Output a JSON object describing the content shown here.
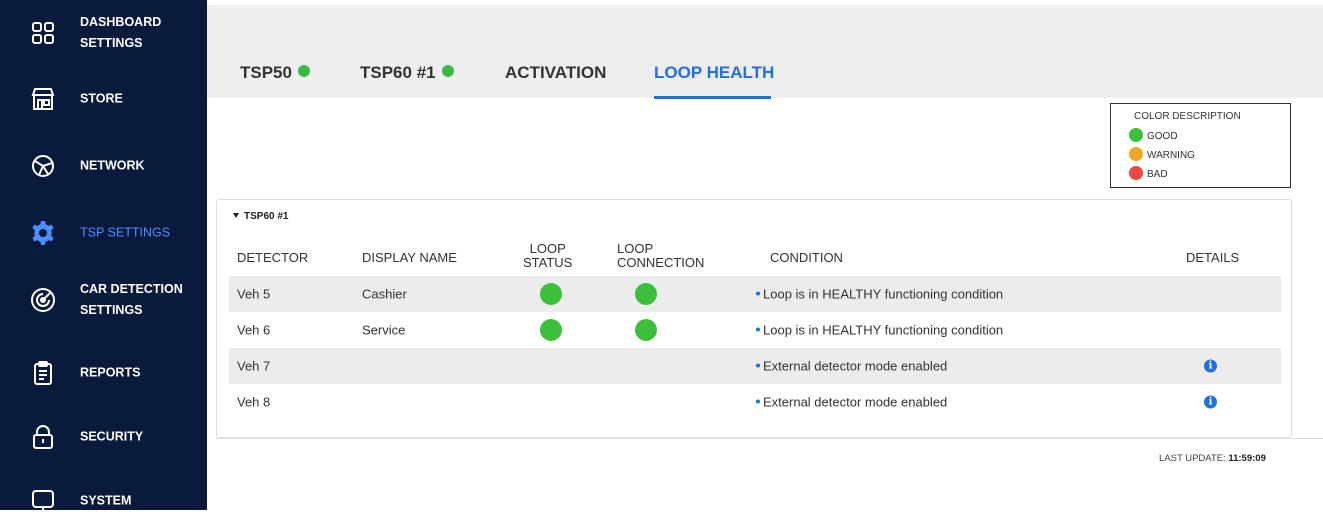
{
  "sidebar": {
    "items": [
      {
        "label": "DASHBOARD SETTINGS",
        "icon": "grid-icon",
        "active": false
      },
      {
        "label": "STORE",
        "icon": "store-icon",
        "active": false
      },
      {
        "label": "NETWORK",
        "icon": "network-icon",
        "active": false
      },
      {
        "label": "TSP SETTINGS",
        "icon": "gear-icon",
        "active": true
      },
      {
        "label": "CAR DETECTION SETTINGS",
        "icon": "sensor-icon",
        "active": false
      },
      {
        "label": "REPORTS",
        "icon": "clipboard-icon",
        "active": false
      },
      {
        "label": "SECURITY",
        "icon": "lock-icon",
        "active": false
      },
      {
        "label": "SYSTEM",
        "icon": "monitor-icon",
        "active": false
      }
    ]
  },
  "tabs": [
    {
      "label": "TSP50",
      "status_dot": true
    },
    {
      "label": "TSP60 #1",
      "status_dot": true
    },
    {
      "label": "ACTIVATION",
      "status_dot": false
    },
    {
      "label": "LOOP HEALTH",
      "status_dot": false,
      "active": true
    }
  ],
  "legend": {
    "title": "COLOR DESCRIPTION",
    "items": [
      {
        "label": "GOOD",
        "color": "#3cc03c"
      },
      {
        "label": "WARNING",
        "color": "#f0a820"
      },
      {
        "label": "BAD",
        "color": "#e84848"
      }
    ]
  },
  "panel": {
    "title": "TSP60 #1",
    "columns": {
      "detector": "DETECTOR",
      "display_name": "DISPLAY NAME",
      "loop_status_1": "LOOP",
      "loop_status_2": "STATUS",
      "loop_connection_1": "LOOP",
      "loop_connection_2": "CONNECTION",
      "condition": "CONDITION",
      "details": "DETAILS"
    },
    "rows": [
      {
        "detector": "Veh 5",
        "display_name": "Cashier",
        "loop_status": "GOOD",
        "loop_connection": "GOOD",
        "condition": "Loop is in HEALTHY functioning condition",
        "details": false
      },
      {
        "detector": "Veh 6",
        "display_name": "Service",
        "loop_status": "GOOD",
        "loop_connection": "GOOD",
        "condition": "Loop is in HEALTHY functioning condition",
        "details": false
      },
      {
        "detector": "Veh 7",
        "display_name": "",
        "loop_status": "",
        "loop_connection": "",
        "condition": "External detector mode enabled",
        "details": true
      },
      {
        "detector": "Veh 8",
        "display_name": "",
        "loop_status": "",
        "loop_connection": "",
        "condition": "External detector mode enabled",
        "details": true
      }
    ]
  },
  "footer": {
    "last_update_label": "LAST UPDATE: ",
    "last_update_time": "11:59:09"
  },
  "colors": {
    "sidebar_bg": "#0a1a3c",
    "accent": "#1f6fe5",
    "good": "#3cc03c"
  }
}
